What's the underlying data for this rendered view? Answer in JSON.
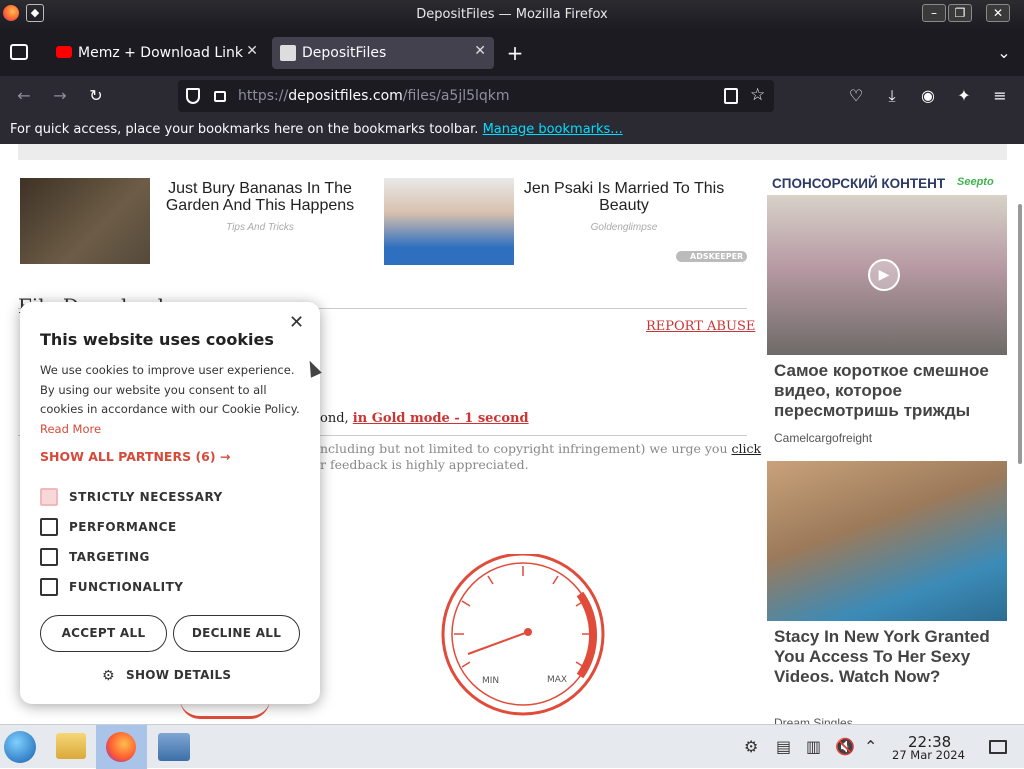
{
  "window": {
    "title": "DepositFiles — Mozilla Firefox",
    "controls": [
      "–",
      "❐",
      "✕"
    ]
  },
  "tabs": [
    {
      "label": "Memz + Download Link -",
      "active": false
    },
    {
      "label": "DepositFiles",
      "active": true
    }
  ],
  "nav": {
    "url_scheme": "https://",
    "url_host": "depositfiles.com",
    "url_path": "/files/a5jl5lqkm"
  },
  "bookmarks_bar": {
    "text": "For quick access, place your bookmarks here on the bookmarks toolbar.",
    "link": "Manage bookmarks..."
  },
  "page": {
    "ads": [
      {
        "title": "Just Bury Bananas In The Garden And This Happens",
        "source": "Tips And Tricks"
      },
      {
        "title": "Jen Psaki Is Married To This Beauty",
        "source": "Goldenglimpse"
      }
    ],
    "adskeeper": "ADSKEEPER",
    "file_heading": "File Download",
    "report_abuse": "REPORT ABUSE",
    "gold_mode_prefix": "ond,",
    "gold_mode_link": "in Gold mode - 1 second",
    "notice_line1": "ncluding but not limited to copyright infringement) we urge you",
    "notice_click": "click",
    "notice_line2": "r feedback is highly appreciated.",
    "gauge_min": "MIN",
    "gauge_max": "MAX",
    "sponsor_label": "СПОНСОРСКИЙ КОНТЕНТ",
    "sponsor_brand": "Seepto",
    "side_ads": [
      {
        "title": "Самое короткое смешное видео, которое пересмотришь трижды",
        "source": "Camelcargofreight"
      },
      {
        "title": "Stacy In New York Granted You Access To Her Sexy Videos. Watch Now?",
        "source": "Dream Singles"
      }
    ]
  },
  "cookie_dialog": {
    "title": "This website uses cookies",
    "body": "We use cookies to improve user experience. By using our website you consent to all cookies in accordance with our Cookie Policy.",
    "read_more": "Read More",
    "show_partners": "SHOW ALL PARTNERS (6) →",
    "options": [
      {
        "label": "STRICTLY NECESSARY",
        "checked": true
      },
      {
        "label": "PERFORMANCE",
        "checked": false
      },
      {
        "label": "TARGETING",
        "checked": false
      },
      {
        "label": "FUNCTIONALITY",
        "checked": false
      }
    ],
    "accept": "ACCEPT ALL",
    "decline": "DECLINE ALL",
    "show_details": "SHOW DETAILS",
    "close": "✕"
  },
  "taskbar": {
    "time": "22:38",
    "date": "27 Mar 2024"
  },
  "colors": {
    "accent_link": "#00ddff",
    "report_red": "#cc3333",
    "cookie_red": "#d64a3a"
  }
}
